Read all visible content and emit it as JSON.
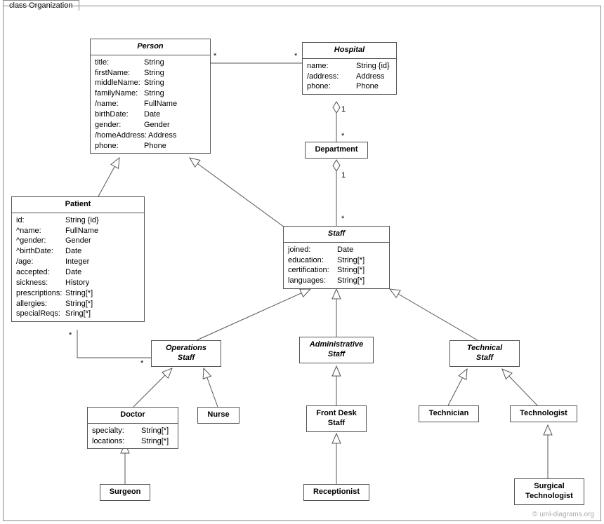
{
  "frame_label": "class Organization",
  "watermark": "© uml-diagrams.org",
  "classes": {
    "person": {
      "name": "Person",
      "attrs": [
        {
          "name": "title:",
          "type": "String"
        },
        {
          "name": "firstName:",
          "type": "String"
        },
        {
          "name": "middleName:",
          "type": "String"
        },
        {
          "name": "familyName:",
          "type": "String"
        },
        {
          "name": "/name:",
          "type": "FullName"
        },
        {
          "name": "birthDate:",
          "type": "Date"
        },
        {
          "name": "gender:",
          "type": "Gender"
        },
        {
          "name": "/homeAddress:",
          "type": "Address"
        },
        {
          "name": "phone:",
          "type": "Phone"
        }
      ]
    },
    "hospital": {
      "name": "Hospital",
      "attrs": [
        {
          "name": "name:",
          "type": "String {id}"
        },
        {
          "name": "/address:",
          "type": "Address"
        },
        {
          "name": "phone:",
          "type": "Phone"
        }
      ]
    },
    "department": {
      "name": "Department"
    },
    "patient": {
      "name": "Patient",
      "attrs": [
        {
          "name": "id:",
          "type": "String {id}"
        },
        {
          "name": "^name:",
          "type": "FullName"
        },
        {
          "name": "^gender:",
          "type": "Gender"
        },
        {
          "name": "^birthDate:",
          "type": "Date"
        },
        {
          "name": "/age:",
          "type": "Integer"
        },
        {
          "name": "accepted:",
          "type": "Date"
        },
        {
          "name": "sickness:",
          "type": "History"
        },
        {
          "name": "prescriptions:",
          "type": "String[*]"
        },
        {
          "name": "allergies:",
          "type": "String[*]"
        },
        {
          "name": "specialReqs:",
          "type": "Sring[*]"
        }
      ]
    },
    "staff": {
      "name": "Staff",
      "attrs": [
        {
          "name": "joined:",
          "type": "Date"
        },
        {
          "name": "education:",
          "type": "String[*]"
        },
        {
          "name": "certification:",
          "type": "String[*]"
        },
        {
          "name": "languages:",
          "type": "String[*]"
        }
      ]
    },
    "operations_staff": {
      "name": "Operations\nStaff"
    },
    "administrative_staff": {
      "name": "Administrative\nStaff"
    },
    "technical_staff": {
      "name": "Technical\nStaff"
    },
    "doctor": {
      "name": "Doctor",
      "attrs": [
        {
          "name": "specialty:",
          "type": "String[*]"
        },
        {
          "name": "locations:",
          "type": "String[*]"
        }
      ]
    },
    "nurse": {
      "name": "Nurse"
    },
    "front_desk_staff": {
      "name": "Front Desk\nStaff"
    },
    "technician": {
      "name": "Technician"
    },
    "technologist": {
      "name": "Technologist"
    },
    "surgeon": {
      "name": "Surgeon"
    },
    "receptionist": {
      "name": "Receptionist"
    },
    "surgical_technologist": {
      "name": "Surgical\nTechnologist"
    }
  },
  "mult": {
    "person_hosp_p": "*",
    "person_hosp_h": "*",
    "hosp_dept_h": "1",
    "hosp_dept_d": "*",
    "dept_staff_d": "1",
    "dept_staff_s": "*",
    "patient_ops_p": "*",
    "patient_ops_o": "*"
  }
}
